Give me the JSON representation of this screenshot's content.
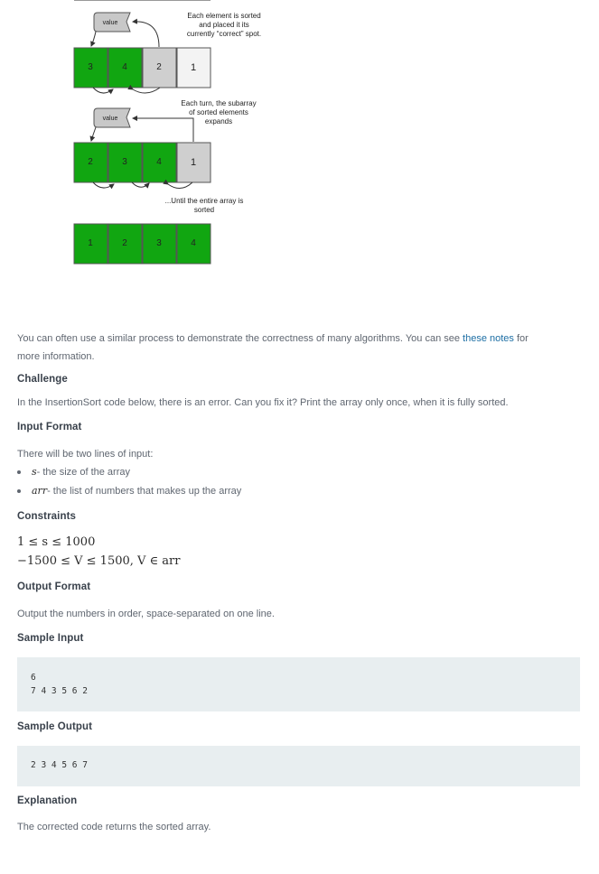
{
  "diagram": {
    "value_label": "value",
    "note1": [
      "Each element is sorted",
      "and placed it its",
      "currently “correct” spot."
    ],
    "note2": [
      "Each turn, the subarray",
      "of sorted elements",
      "expands"
    ],
    "note3": [
      "...Until the entire array is",
      "sorted"
    ],
    "row1": [
      "3",
      "4",
      "2",
      "1"
    ],
    "row2": [
      "2",
      "3",
      "4",
      "1"
    ],
    "row3": [
      "1",
      "2",
      "3",
      "4"
    ],
    "colors": {
      "sorted": "#11a611",
      "unsorted": "#cfcfcf",
      "value_box": "#c8c8c8"
    }
  },
  "body": {
    "intro_text": "You can often use a similar process to demonstrate the correctness of many algorithms. You can see ",
    "intro_link": "these notes",
    "intro_after": " for",
    "intro_line2": "more information.",
    "challenge_heading": "Challenge",
    "challenge_text": "In the InsertionSort code below, there is an error. Can you fix it? Print the array only once, when it is fully sorted.",
    "input_heading": "Input Format",
    "input_text": "There will be two lines of input:",
    "bullets": [
      {
        "var": "s",
        "desc": " - the size of the array"
      },
      {
        "var": "arr",
        "desc": " - the list of numbers that makes up the array"
      }
    ],
    "constraints_heading": "Constraints",
    "constraint1": "1 ≤ s ≤ 1000",
    "constraint2": "−1500 ≤ V ≤ 1500, V ∈ arr",
    "output_heading": "Output Format",
    "output_text": "Output the numbers in order, space-separated on one line.",
    "sample_input_heading": "Sample Input",
    "sample_input_lines": [
      "6",
      "7 4 3 5 6 2"
    ],
    "sample_output_heading": "Sample Output",
    "sample_output_lines": [
      "2 3 4 5 6 7"
    ],
    "explanation_heading": "Explanation",
    "explanation_text": "The corrected code returns the sorted array."
  }
}
